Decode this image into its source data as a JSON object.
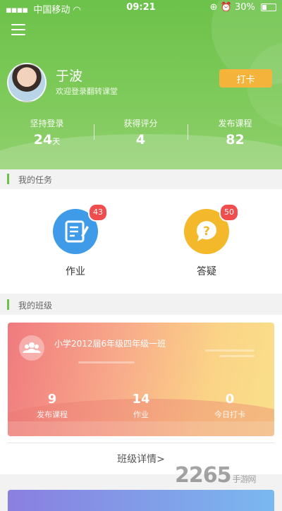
{
  "status_bar": {
    "carrier": "中国移动",
    "time": "09:21",
    "battery": "30%"
  },
  "profile": {
    "name": "于波",
    "welcome": "欢迎登录翻转课堂",
    "checkin_label": "打卡"
  },
  "stats": [
    {
      "label": "坚持登录",
      "value": "24",
      "unit": "天"
    },
    {
      "label": "获得评分",
      "value": "4",
      "unit": ""
    },
    {
      "label": "发布课程",
      "value": "82",
      "unit": ""
    }
  ],
  "tasks_section": {
    "title": "我的任务"
  },
  "tasks": [
    {
      "label": "作业",
      "badge": "43",
      "icon": "homework-icon",
      "color": "#3f9be8"
    },
    {
      "label": "答疑",
      "badge": "50",
      "icon": "question-icon",
      "color": "#f3b92b"
    }
  ],
  "classes_section": {
    "title": "我的班级"
  },
  "class_card": {
    "name": "小学2012届6年级四年级一班",
    "stats": [
      {
        "value": "9",
        "label": "发布课程"
      },
      {
        "value": "14",
        "label": "作业"
      },
      {
        "value": "0",
        "label": "今日打卡"
      }
    ],
    "detail_label": "班级详情>"
  },
  "watermark": {
    "text": "2265",
    "suffix": "手游网"
  },
  "colors": {
    "primary": "#6cc24a",
    "accent": "#f4b43b",
    "badge": "#f04e4e"
  }
}
